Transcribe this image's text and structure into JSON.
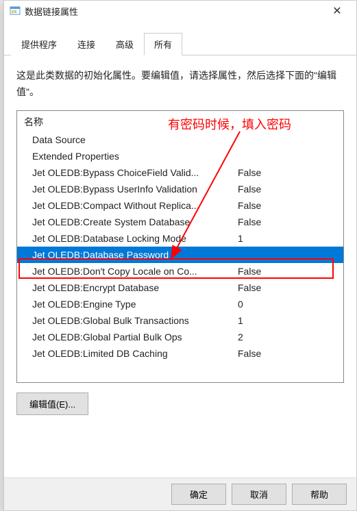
{
  "window": {
    "title": "数据链接属性"
  },
  "tabs": [
    {
      "label": "提供程序",
      "active": false
    },
    {
      "label": "连接",
      "active": false
    },
    {
      "label": "高级",
      "active": false
    },
    {
      "label": "所有",
      "active": true
    }
  ],
  "instructions": "这是此类数据的初始化属性。要编辑值，请选择属性，然后选择下面的\"编辑值\"。",
  "list_header": "名称",
  "properties": [
    {
      "name": "Data Source",
      "value": ""
    },
    {
      "name": "Extended Properties",
      "value": ""
    },
    {
      "name": "Jet OLEDB:Bypass ChoiceField Valid...",
      "value": "False"
    },
    {
      "name": "Jet OLEDB:Bypass UserInfo Validation",
      "value": "False"
    },
    {
      "name": "Jet OLEDB:Compact Without Replica...",
      "value": "False"
    },
    {
      "name": "Jet OLEDB:Create System Database",
      "value": "False"
    },
    {
      "name": "Jet OLEDB:Database Locking Mode",
      "value": "1"
    },
    {
      "name": "Jet OLEDB:Database Password",
      "value": "",
      "selected": true
    },
    {
      "name": "Jet OLEDB:Don't Copy Locale on Co...",
      "value": "False"
    },
    {
      "name": "Jet OLEDB:Encrypt Database",
      "value": "False"
    },
    {
      "name": "Jet OLEDB:Engine Type",
      "value": "0"
    },
    {
      "name": "Jet OLEDB:Global Bulk Transactions",
      "value": "1"
    },
    {
      "name": "Jet OLEDB:Global Partial Bulk Ops",
      "value": "2"
    },
    {
      "name": "Jet OLEDB:Limited DB Caching",
      "value": "False"
    }
  ],
  "buttons": {
    "edit": "编辑值(E)...",
    "ok": "确定",
    "cancel": "取消",
    "help": "帮助"
  },
  "annotation": {
    "text": "有密码时候，填入密码"
  }
}
